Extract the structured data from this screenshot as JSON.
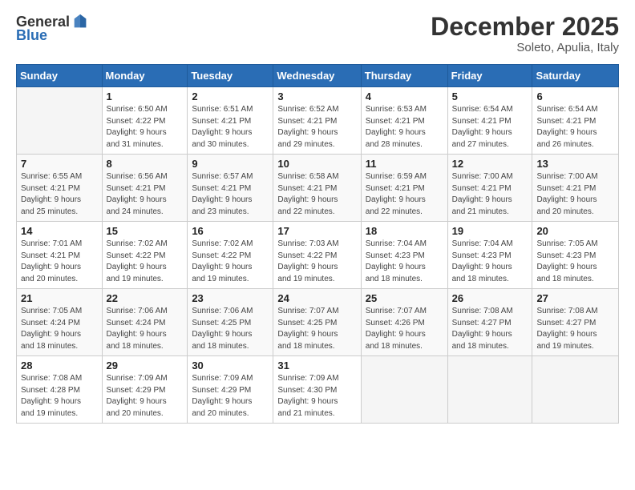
{
  "header": {
    "logo_general": "General",
    "logo_blue": "Blue",
    "month": "December 2025",
    "location": "Soleto, Apulia, Italy"
  },
  "columns": [
    "Sunday",
    "Monday",
    "Tuesday",
    "Wednesday",
    "Thursday",
    "Friday",
    "Saturday"
  ],
  "weeks": [
    [
      {
        "num": "",
        "info": ""
      },
      {
        "num": "1",
        "info": "Sunrise: 6:50 AM\nSunset: 4:22 PM\nDaylight: 9 hours\nand 31 minutes."
      },
      {
        "num": "2",
        "info": "Sunrise: 6:51 AM\nSunset: 4:21 PM\nDaylight: 9 hours\nand 30 minutes."
      },
      {
        "num": "3",
        "info": "Sunrise: 6:52 AM\nSunset: 4:21 PM\nDaylight: 9 hours\nand 29 minutes."
      },
      {
        "num": "4",
        "info": "Sunrise: 6:53 AM\nSunset: 4:21 PM\nDaylight: 9 hours\nand 28 minutes."
      },
      {
        "num": "5",
        "info": "Sunrise: 6:54 AM\nSunset: 4:21 PM\nDaylight: 9 hours\nand 27 minutes."
      },
      {
        "num": "6",
        "info": "Sunrise: 6:54 AM\nSunset: 4:21 PM\nDaylight: 9 hours\nand 26 minutes."
      }
    ],
    [
      {
        "num": "7",
        "info": "Sunrise: 6:55 AM\nSunset: 4:21 PM\nDaylight: 9 hours\nand 25 minutes."
      },
      {
        "num": "8",
        "info": "Sunrise: 6:56 AM\nSunset: 4:21 PM\nDaylight: 9 hours\nand 24 minutes."
      },
      {
        "num": "9",
        "info": "Sunrise: 6:57 AM\nSunset: 4:21 PM\nDaylight: 9 hours\nand 23 minutes."
      },
      {
        "num": "10",
        "info": "Sunrise: 6:58 AM\nSunset: 4:21 PM\nDaylight: 9 hours\nand 22 minutes."
      },
      {
        "num": "11",
        "info": "Sunrise: 6:59 AM\nSunset: 4:21 PM\nDaylight: 9 hours\nand 22 minutes."
      },
      {
        "num": "12",
        "info": "Sunrise: 7:00 AM\nSunset: 4:21 PM\nDaylight: 9 hours\nand 21 minutes."
      },
      {
        "num": "13",
        "info": "Sunrise: 7:00 AM\nSunset: 4:21 PM\nDaylight: 9 hours\nand 20 minutes."
      }
    ],
    [
      {
        "num": "14",
        "info": "Sunrise: 7:01 AM\nSunset: 4:21 PM\nDaylight: 9 hours\nand 20 minutes."
      },
      {
        "num": "15",
        "info": "Sunrise: 7:02 AM\nSunset: 4:22 PM\nDaylight: 9 hours\nand 19 minutes."
      },
      {
        "num": "16",
        "info": "Sunrise: 7:02 AM\nSunset: 4:22 PM\nDaylight: 9 hours\nand 19 minutes."
      },
      {
        "num": "17",
        "info": "Sunrise: 7:03 AM\nSunset: 4:22 PM\nDaylight: 9 hours\nand 19 minutes."
      },
      {
        "num": "18",
        "info": "Sunrise: 7:04 AM\nSunset: 4:23 PM\nDaylight: 9 hours\nand 18 minutes."
      },
      {
        "num": "19",
        "info": "Sunrise: 7:04 AM\nSunset: 4:23 PM\nDaylight: 9 hours\nand 18 minutes."
      },
      {
        "num": "20",
        "info": "Sunrise: 7:05 AM\nSunset: 4:23 PM\nDaylight: 9 hours\nand 18 minutes."
      }
    ],
    [
      {
        "num": "21",
        "info": "Sunrise: 7:05 AM\nSunset: 4:24 PM\nDaylight: 9 hours\nand 18 minutes."
      },
      {
        "num": "22",
        "info": "Sunrise: 7:06 AM\nSunset: 4:24 PM\nDaylight: 9 hours\nand 18 minutes."
      },
      {
        "num": "23",
        "info": "Sunrise: 7:06 AM\nSunset: 4:25 PM\nDaylight: 9 hours\nand 18 minutes."
      },
      {
        "num": "24",
        "info": "Sunrise: 7:07 AM\nSunset: 4:25 PM\nDaylight: 9 hours\nand 18 minutes."
      },
      {
        "num": "25",
        "info": "Sunrise: 7:07 AM\nSunset: 4:26 PM\nDaylight: 9 hours\nand 18 minutes."
      },
      {
        "num": "26",
        "info": "Sunrise: 7:08 AM\nSunset: 4:27 PM\nDaylight: 9 hours\nand 18 minutes."
      },
      {
        "num": "27",
        "info": "Sunrise: 7:08 AM\nSunset: 4:27 PM\nDaylight: 9 hours\nand 19 minutes."
      }
    ],
    [
      {
        "num": "28",
        "info": "Sunrise: 7:08 AM\nSunset: 4:28 PM\nDaylight: 9 hours\nand 19 minutes."
      },
      {
        "num": "29",
        "info": "Sunrise: 7:09 AM\nSunset: 4:29 PM\nDaylight: 9 hours\nand 20 minutes."
      },
      {
        "num": "30",
        "info": "Sunrise: 7:09 AM\nSunset: 4:29 PM\nDaylight: 9 hours\nand 20 minutes."
      },
      {
        "num": "31",
        "info": "Sunrise: 7:09 AM\nSunset: 4:30 PM\nDaylight: 9 hours\nand 21 minutes."
      },
      {
        "num": "",
        "info": ""
      },
      {
        "num": "",
        "info": ""
      },
      {
        "num": "",
        "info": ""
      }
    ]
  ]
}
